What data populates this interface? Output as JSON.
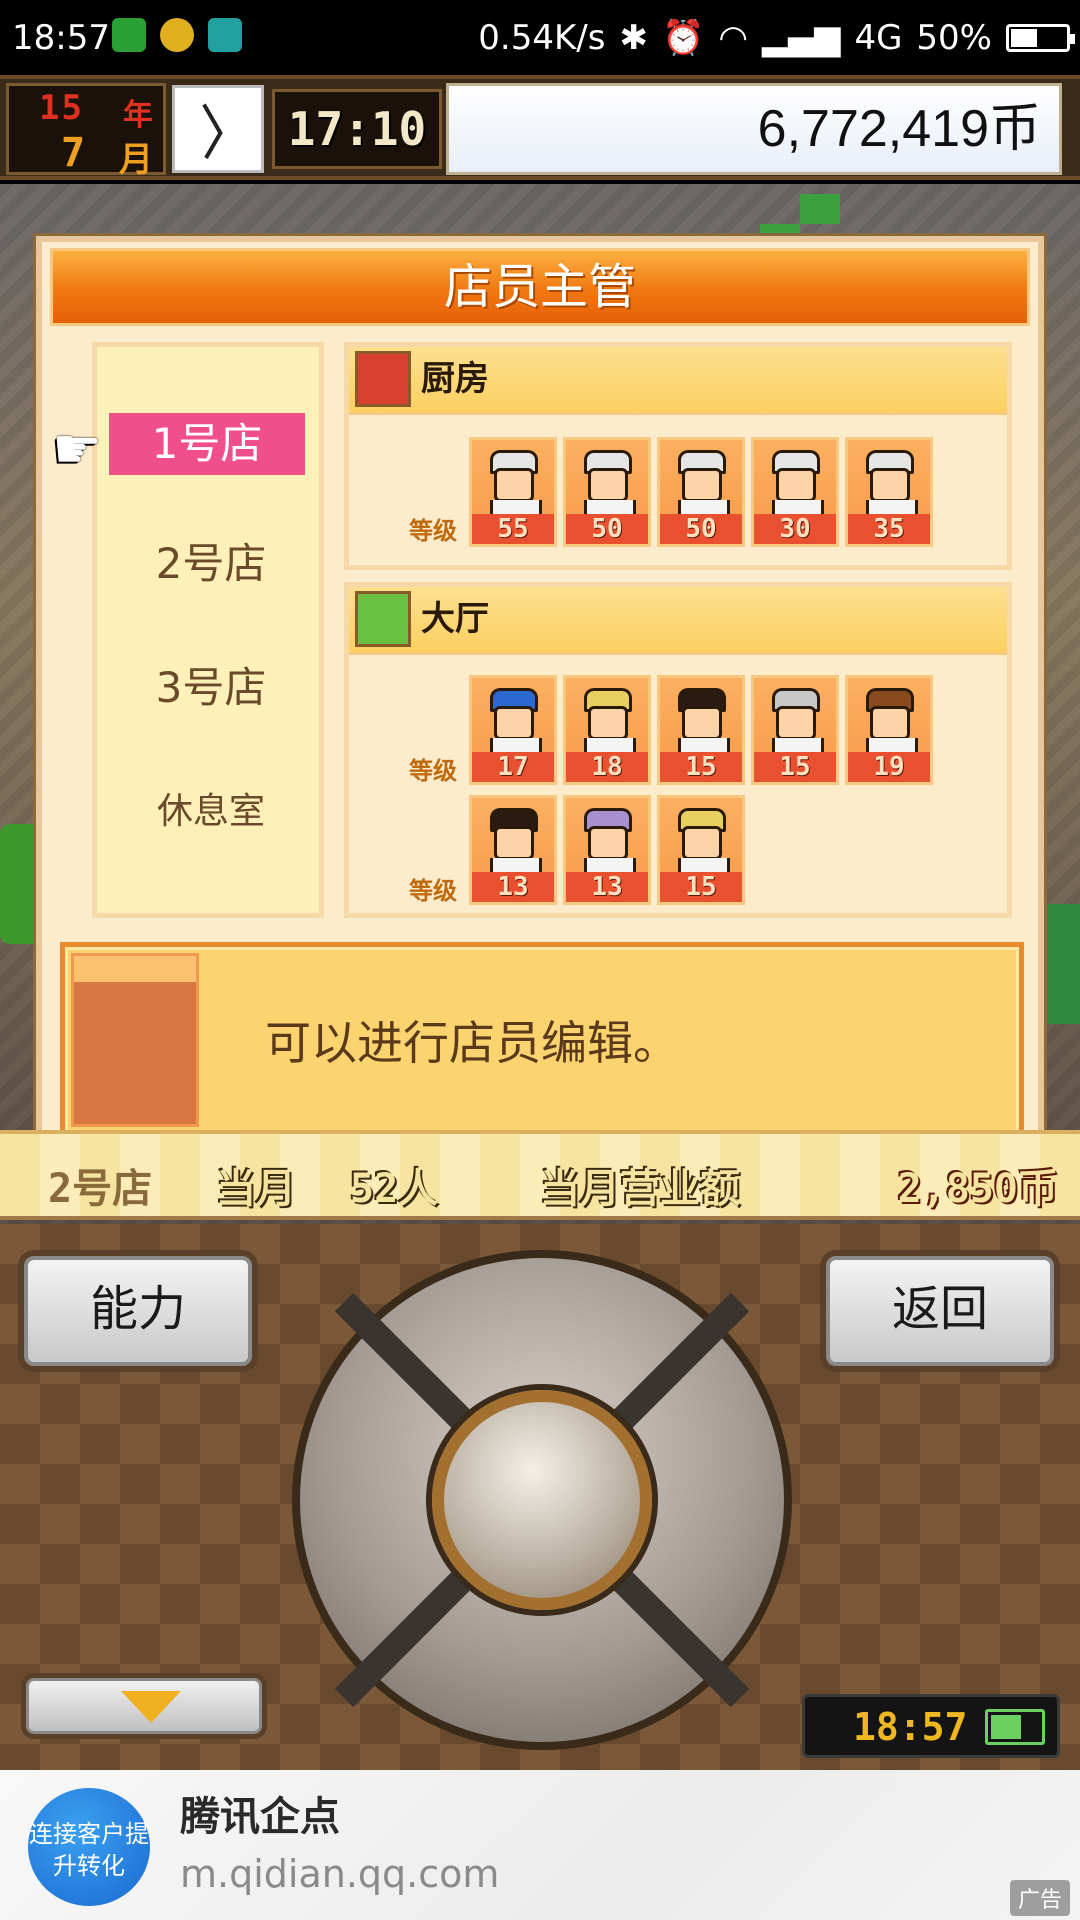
{
  "status_bar": {
    "time": "18:57",
    "net_speed": "0.54K/s",
    "network": "4G",
    "battery": "50%"
  },
  "game_header": {
    "year": "15",
    "year_unit": "年",
    "month": "7",
    "month_unit": "月",
    "clock_time": "17:10",
    "money": "6,772,419币"
  },
  "dialog": {
    "title": "店员主管",
    "stores": [
      {
        "label": "1号店",
        "active": true
      },
      {
        "label": "2号店",
        "active": false
      },
      {
        "label": "3号店",
        "active": false
      },
      {
        "label": "休息室",
        "active": false
      }
    ],
    "level_label": "等级",
    "kitchen": {
      "label": "厨房",
      "levels": [
        "55",
        "50",
        "50",
        "30",
        "35"
      ]
    },
    "hall": {
      "label": "大厅",
      "levels_row1": [
        "17",
        "18",
        "15",
        "15",
        "19"
      ],
      "levels_row2": [
        "13",
        "13",
        "15"
      ]
    },
    "message": "可以进行店员编辑。"
  },
  "summary_strip": {
    "store": "2号店",
    "this_month": "当月",
    "customers": "52人",
    "monthly_sales": "当月营业额",
    "sales_value": "2,850币"
  },
  "controls": {
    "ability_button": "能力",
    "back_button": "返回",
    "lcd_time": "18:57"
  },
  "ad": {
    "logo_text": "连接客户提升转化",
    "title": "腾讯企点",
    "url": "m.qidian.qq.com",
    "tag": "广告"
  },
  "colors": {
    "title_orange": "#f07810",
    "active_store": "#f0508a",
    "level_badge": "#e85030",
    "panel_bg": "#fdeccc"
  }
}
